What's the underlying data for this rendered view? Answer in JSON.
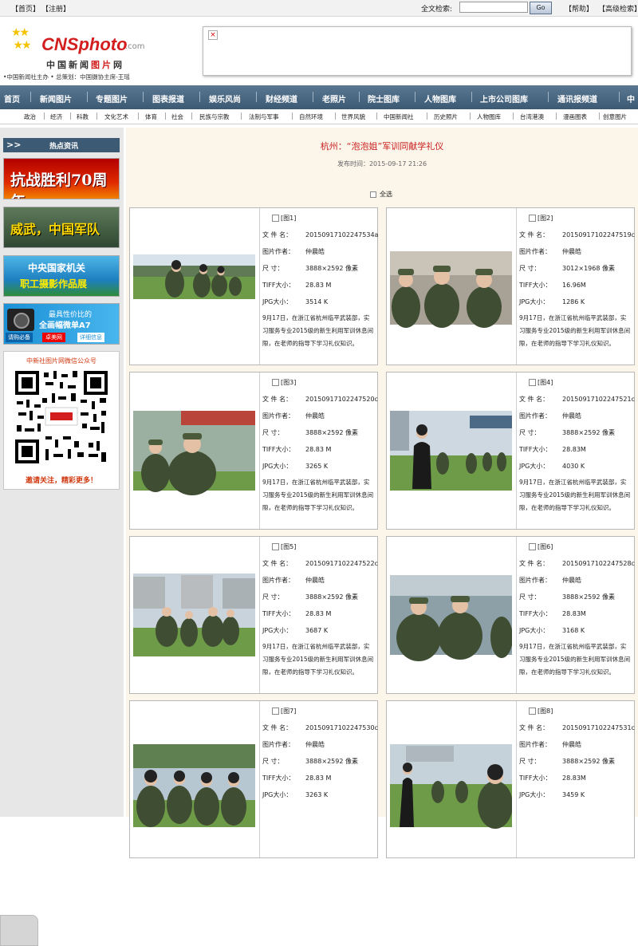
{
  "topbar": {
    "left_links": [
      "【首页】",
      "【注册】"
    ],
    "search_label": "全文检索:",
    "search_value": "",
    "go_label": "Go",
    "help_link": "【帮助】",
    "advanced_link": "【高级检索】"
  },
  "header": {
    "logo_word": "CNSphoto",
    "logo_domain": ".com",
    "logo_cn_a": "中国新闻",
    "logo_cn_b": "图片",
    "logo_cn_c": "网",
    "tagline": "•中国新闻社主办 • 总策划：中国摄协主席-王瑶"
  },
  "nav": {
    "items": [
      "首页",
      "新闻图片",
      "专题图片",
      "图表报道",
      "娱乐风尚",
      "财经频道",
      "老照片",
      "院士图库",
      "人物图库",
      "上市公司图库",
      "通讯报频道",
      "中"
    ]
  },
  "subnav": {
    "items": [
      "政治",
      "经济",
      "科教",
      "文化艺术",
      "体育",
      "社会",
      "民族与宗教",
      "法制与军事",
      "自然环境",
      "世界风貌",
      "中国新闻社",
      "历史照片",
      "人物图库",
      "台湾港澳",
      "漫画图表",
      "创意图片"
    ]
  },
  "sidebar": {
    "title_arrow": ">>",
    "title": "热点资讯",
    "ad1": "抗战胜利70周年",
    "ad2": "威武，中国军队",
    "ad3_line1": "中央国家机关",
    "ad3_line2": "职工摄影作品展",
    "ad4_line1": "最具性价比的",
    "ad4_line2": "全画幅微单A7",
    "ad4_b1": "请购必备",
    "ad4_b2": "卓美网",
    "ad4_b3": "详细信息",
    "qr_title": "中新社图片网微信公众号",
    "qr_caption": "邀请关注，精彩更多！"
  },
  "content": {
    "title": "杭州：“泡泡姐”军训同献学礼仪",
    "time_label": "发布时间：",
    "time_value": "2015-09-17 21:26",
    "select_all": "全选",
    "labels": {
      "file": "文 件 名：",
      "author": "图片作者：",
      "size": "尺    寸：",
      "tiff": "TIFF大小：",
      "jpg": "JPG大小："
    },
    "photos": [
      {
        "no": "[图1]",
        "file": "20150917102247534a",
        "author": "仲晨皓",
        "dim": "3888×2592 像素",
        "tiff": "28.83 M",
        "jpg": "3514 K",
        "desc": "9月17日，在浙江省杭州临平武装部，实习服务专业2015级的新生利用军训休息间隙，在老师的指导下学习礼仪知识。"
      },
      {
        "no": "[图2]",
        "file": "20150917102247519c",
        "author": "仲晨皓",
        "dim": "3012×1968 像素",
        "tiff": "16.96M",
        "jpg": "1286 K",
        "desc": "9月17日，在浙江省杭州临平武装部，实习服务专业2015级的新生利用军训休息间隙，在老师的指导下学习礼仪知识。"
      },
      {
        "no": "[图3]",
        "file": "20150917102247520c",
        "author": "仲晨皓",
        "dim": "3888×2592 像素",
        "tiff": "28.83 M",
        "jpg": "3265 K",
        "desc": "9月17日，在浙江省杭州临平武装部，实习服务专业2015级的新生利用军训休息间隙，在老师的指导下学习礼仪知识。"
      },
      {
        "no": "[图4]",
        "file": "20150917102247521c",
        "author": "仲晨皓",
        "dim": "3888×2592 像素",
        "tiff": "28.83M",
        "jpg": "4030 K",
        "desc": "9月17日，在浙江省杭州临平武装部，实习服务专业2015级的新生利用军训休息间隙，在老师的指导下学习礼仪知识。"
      },
      {
        "no": "[图5]",
        "file": "20150917102247522c",
        "author": "仲晨皓",
        "dim": "3888×2592 像素",
        "tiff": "28.83 M",
        "jpg": "3687 K",
        "desc": "9月17日，在浙江省杭州临平武装部，实习服务专业2015级的新生利用军训休息间隙，在老师的指导下学习礼仪知识。"
      },
      {
        "no": "[图6]",
        "file": "20150917102247528c",
        "author": "仲晨皓",
        "dim": "3888×2592 像素",
        "tiff": "28.83M",
        "jpg": "3168 K",
        "desc": "9月17日，在浙江省杭州临平武装部，实习服务专业2015级的新生利用军训休息间隙，在老师的指导下学习礼仪知识。"
      },
      {
        "no": "[图7]",
        "file": "20150917102247530c",
        "author": "仲晨皓",
        "dim": "3888×2592 像素",
        "tiff": "28.83 M",
        "jpg": "3263 K",
        "desc": "9月17日，在浙江省杭州临平武装部，实习服务专业2015级的新生利用军训休息间隙，在老师的指导下学习礼仪知识。"
      },
      {
        "no": "[图8]",
        "file": "20150917102247531c",
        "author": "仲晨皓",
        "dim": "3888×2592 像素",
        "tiff": "28.83M",
        "jpg": "3459 K",
        "desc": "9月17日，在浙江省杭州临平武装部，实习服务专业2015级的新生利用军训休息间隙，在老师的指导下学习礼仪知识。"
      }
    ]
  }
}
